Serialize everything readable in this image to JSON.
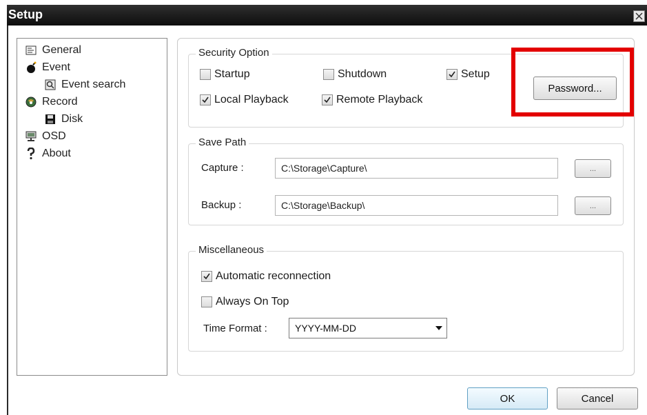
{
  "window": {
    "title": "Setup"
  },
  "sidebar": {
    "items": [
      {
        "label": "General",
        "icon": "general-icon"
      },
      {
        "label": "Event",
        "icon": "event-icon"
      },
      {
        "label": "Event search",
        "icon": "event-search-icon"
      },
      {
        "label": "Record",
        "icon": "record-icon"
      },
      {
        "label": "Disk",
        "icon": "disk-icon"
      },
      {
        "label": "OSD",
        "icon": "osd-icon"
      },
      {
        "label": "About",
        "icon": "about-icon"
      }
    ]
  },
  "security": {
    "title": "Security Option",
    "startup": {
      "label": "Startup",
      "checked": false
    },
    "shutdown": {
      "label": "Shutdown",
      "checked": false
    },
    "setup": {
      "label": "Setup",
      "checked": true
    },
    "local_playback": {
      "label": "Local Playback",
      "checked": true
    },
    "remote_playback": {
      "label": "Remote Playback",
      "checked": true
    },
    "password_button": "Password..."
  },
  "save_path": {
    "title": "Save Path",
    "capture_label": "Capture :",
    "capture_value": "C:\\Storage\\Capture\\",
    "backup_label": "Backup :",
    "backup_value": "C:\\Storage\\Backup\\",
    "browse_label": "..."
  },
  "misc": {
    "title": "Miscellaneous",
    "auto_reconnect": {
      "label": "Automatic reconnection",
      "checked": true
    },
    "always_on_top": {
      "label": "Always On Top",
      "checked": false
    },
    "time_format_label": "Time Format :",
    "time_format_value": "YYYY-MM-DD"
  },
  "footer": {
    "ok": "OK",
    "cancel": "Cancel"
  },
  "colors": {
    "highlight": "#e30000",
    "titlebar": "#1c1c1c"
  }
}
